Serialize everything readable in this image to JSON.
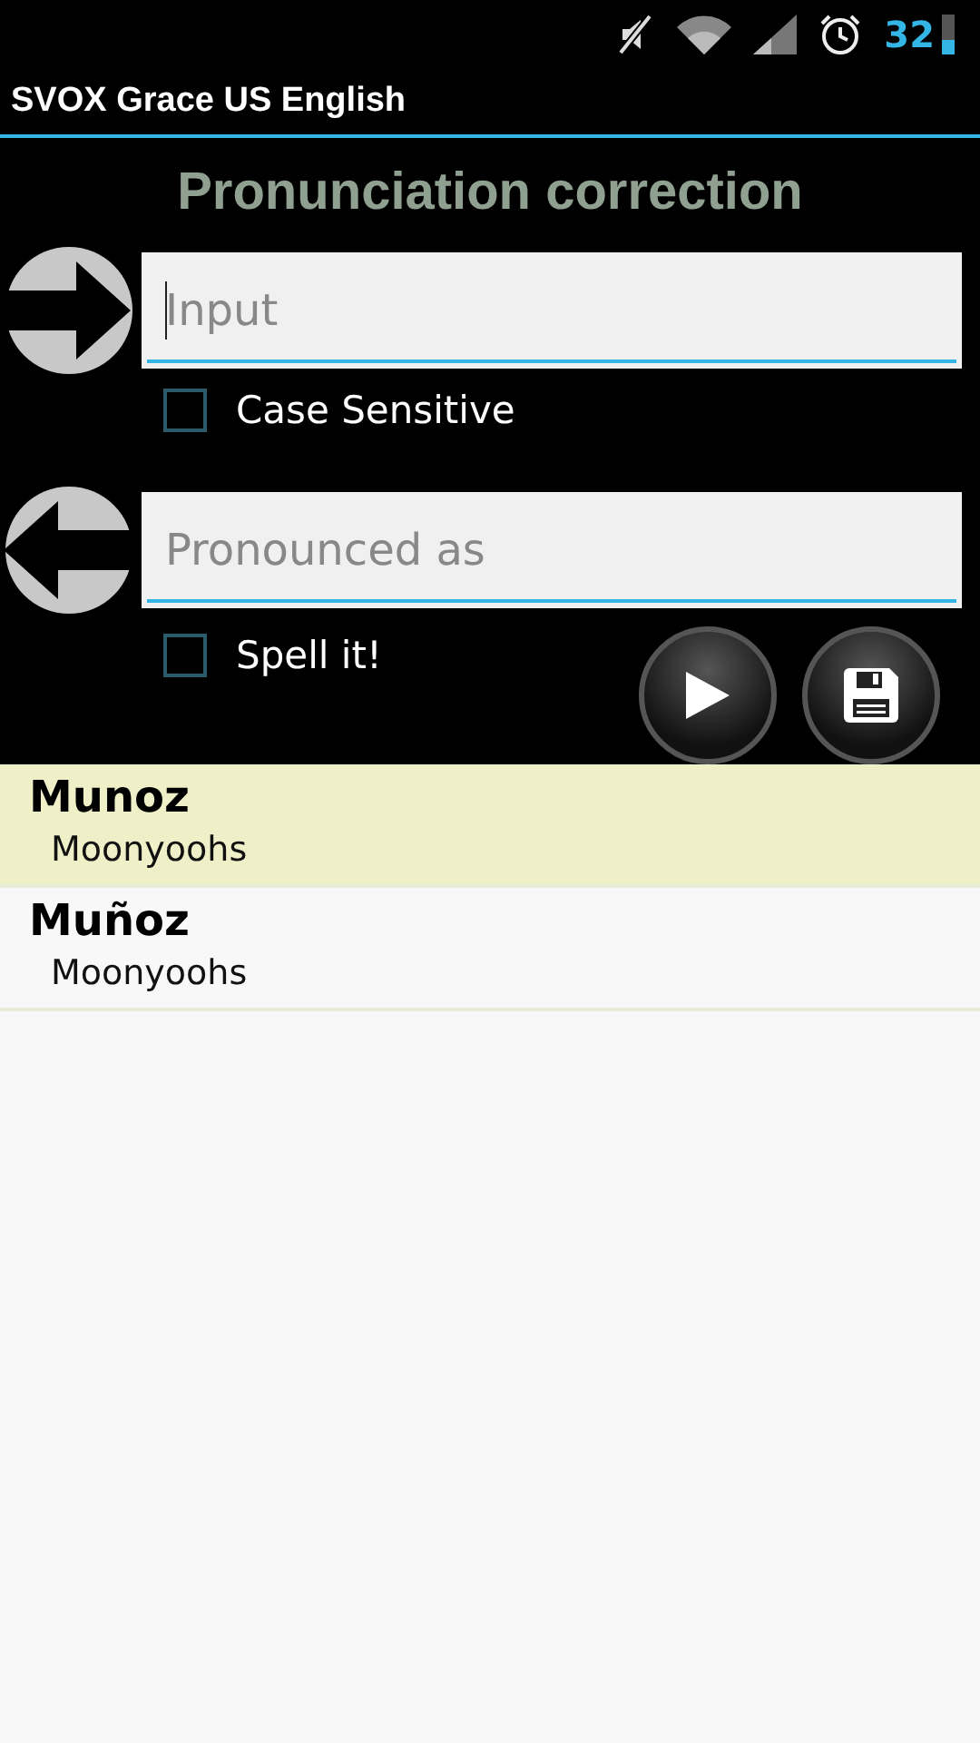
{
  "status_bar": {
    "battery_text": "32"
  },
  "window": {
    "title": "SVOX Grace US English"
  },
  "heading": "Pronunciation correction",
  "input": {
    "placeholder": "Input",
    "focused": true
  },
  "case_sensitive": {
    "label": "Case Sensitive",
    "checked": false
  },
  "pronounced": {
    "placeholder": "Pronounced as"
  },
  "spell_it": {
    "label": "Spell it!",
    "checked": false
  },
  "entries": [
    {
      "word": "Munoz",
      "pronunciation": "Moonyoohs",
      "selected": true
    },
    {
      "word": "Muñoz",
      "pronunciation": "Moonyoohs",
      "selected": false
    }
  ]
}
